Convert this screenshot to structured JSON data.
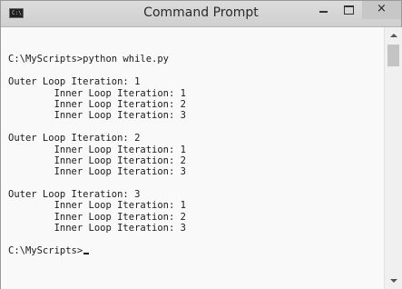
{
  "window": {
    "title": "Command Prompt",
    "app_icon": "terminal-icon",
    "app_icon_text": "C:\\",
    "controls": {
      "minimize": "minimize-icon",
      "maximize": "maximize-icon",
      "close": "close-icon",
      "close_glyph": "×"
    }
  },
  "console": {
    "lines": [
      "",
      "C:\\MyScripts>python while.py",
      "",
      "Outer Loop Iteration: 1",
      "        Inner Loop Iteration: 1",
      "        Inner Loop Iteration: 2",
      "        Inner Loop Iteration: 3",
      "",
      "Outer Loop Iteration: 2",
      "        Inner Loop Iteration: 1",
      "        Inner Loop Iteration: 2",
      "        Inner Loop Iteration: 3",
      "",
      "Outer Loop Iteration: 3",
      "        Inner Loop Iteration: 1",
      "        Inner Loop Iteration: 2",
      "        Inner Loop Iteration: 3",
      "",
      "C:\\MyScripts>"
    ],
    "cursor_line": 18
  },
  "colors": {
    "titlebar": "#d5d5d5",
    "console_background": "#f9f9f9",
    "text": "#1a1a1a"
  }
}
